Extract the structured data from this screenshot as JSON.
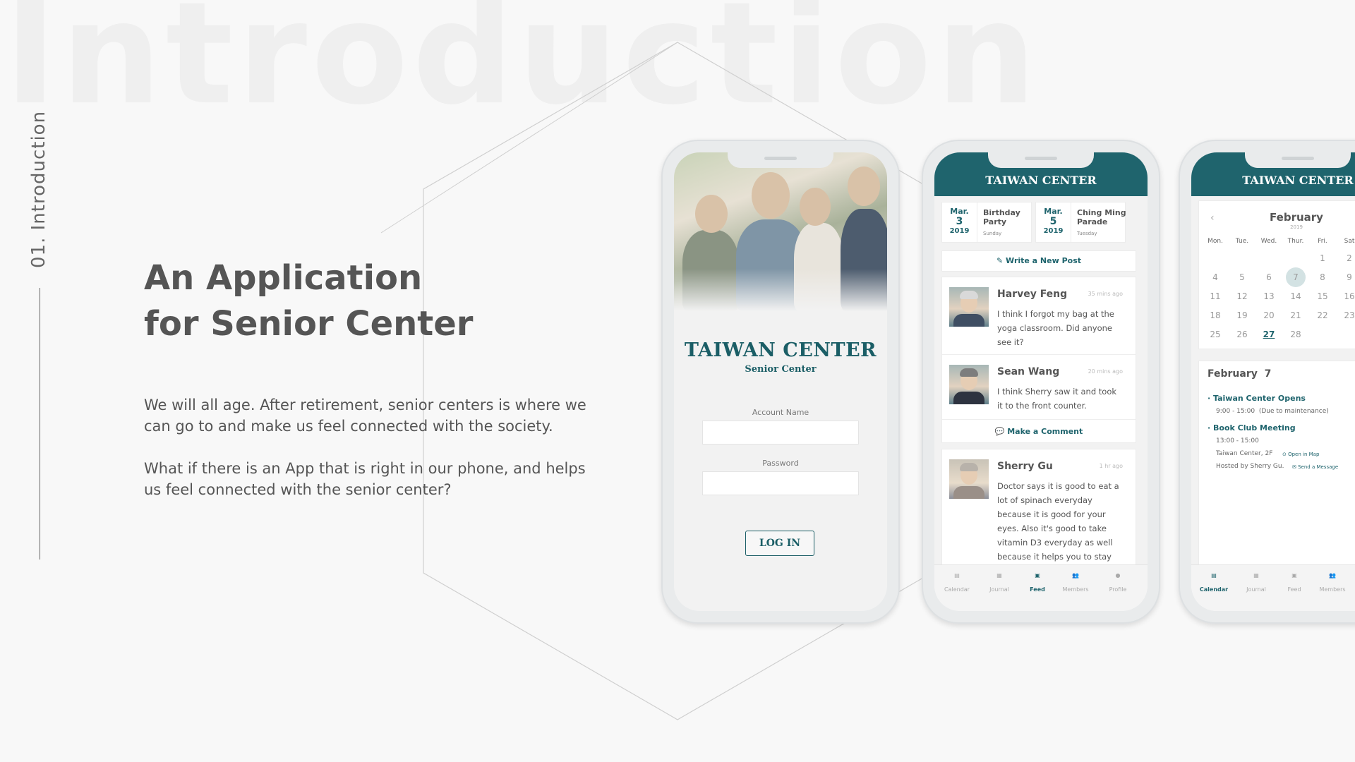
{
  "slide": {
    "background_title": "Introduction",
    "section_label": "01. Introduction",
    "headline_line1": "An Application",
    "headline_line2": "for Senior Center",
    "paragraph1": "We will all age. After retirement, senior centers is where we can go to and make us feel connected with the society.",
    "paragraph2": "What if there is an App that is right in our phone, and helps us feel connected with the senior center?"
  },
  "colors": {
    "accent": "#1f646d",
    "text": "#555555",
    "background": "#f8f8f8"
  },
  "login_screen": {
    "title": "TAIWAN CENTER",
    "subtitle": "Senior Center",
    "account_label": "Account Name",
    "password_label": "Password",
    "login_button": "LOG IN"
  },
  "feed_screen": {
    "header": "TAIWAN CENTER",
    "events": [
      {
        "month": "Mar.",
        "day": "3",
        "year": "2019",
        "name": "Birthday Party",
        "weekday": "Sunday"
      },
      {
        "month": "Mar.",
        "day": "5",
        "year": "2019",
        "name": "Ching Ming Parade",
        "weekday": "Tuesday"
      }
    ],
    "write_post": "Write a New Post",
    "posts": [
      {
        "name": "Harvey Feng",
        "time": "35 mins ago",
        "text": "I think I forgot my bag at the yoga classroom. Did anyone see it?"
      },
      {
        "name": "Sean Wang",
        "time": "20 mins ago",
        "text": "I think Sherry saw it and took it to the front counter."
      },
      {
        "name": "Sherry Gu",
        "time": "1 hr ago",
        "text": "Doctor says it is good to eat a lot of spinach everyday because it is good for your eyes. Also it's good to take vitamin D3 everyday as well because it helps you to stay"
      }
    ],
    "comment_button": "Make a Comment",
    "tabs": [
      "Calendar",
      "Journal",
      "Feed",
      "Members",
      "Profile"
    ],
    "active_tab": "Feed"
  },
  "calendar_screen": {
    "header": "TAIWAN CENTER",
    "month": "February",
    "year": "2019",
    "weekdays": [
      "Mon.",
      "Tue.",
      "Wed.",
      "Thur.",
      "Fri.",
      "Sat"
    ],
    "weeks": [
      [
        "",
        "",
        "",
        "",
        "1",
        "2"
      ],
      [
        "4",
        "5",
        "6",
        "7",
        "8",
        "9"
      ],
      [
        "11",
        "12",
        "13",
        "14",
        "15",
        "16"
      ],
      [
        "18",
        "19",
        "20",
        "21",
        "22",
        "23"
      ],
      [
        "25",
        "26",
        "27",
        "28",
        "",
        ""
      ]
    ],
    "selected_day": "7",
    "today": "27",
    "agenda_month": "February",
    "agenda_day": "7",
    "events": [
      {
        "title": "Taiwan Center Opens",
        "time": "9:00 - 15:00",
        "note": "(Due to maintenance)"
      },
      {
        "title": "Book Club Meeting",
        "time": "13:00 - 15:00",
        "location": "Taiwan Center, 2F",
        "map_link": "Open in Map",
        "host": "Hosted by Sherry Gu.",
        "message_link": "Send a Message"
      }
    ],
    "tabs": [
      "Calendar",
      "Journal",
      "Feed",
      "Members"
    ],
    "active_tab": "Calendar"
  }
}
